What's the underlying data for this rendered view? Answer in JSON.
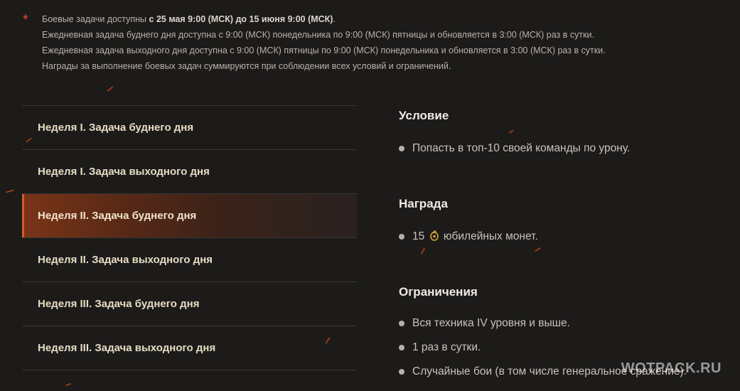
{
  "notes": {
    "asterisk": "*",
    "line1_prefix": "Боевые задачи доступны ",
    "line1_bold": "с 25 мая 9:00 (МСК) до 15 июня 9:00 (МСК)",
    "line1_suffix": ".",
    "line2": "Ежедневная задача буднего дня доступна с 9:00 (МСК) понедельника по 9:00 (МСК) пятницы и обновляется в 3:00 (МСК) раз в сутки.",
    "line3": "Ежедневная задача выходного дня доступна с 9:00 (МСК) пятницы по 9:00 (МСК) понедельника и обновляется в 3:00 (МСК) раз в сутки.",
    "line4": "Награды за выполнение боевых задач суммируются при соблюдении всех условий и ограничений."
  },
  "tasks": [
    {
      "label": "Неделя I. Задача буднего дня"
    },
    {
      "label": "Неделя I. Задача выходного дня"
    },
    {
      "label": "Неделя II. Задача буднего дня"
    },
    {
      "label": "Неделя II. Задача выходного дня"
    },
    {
      "label": "Неделя III. Задача буднего дня"
    },
    {
      "label": "Неделя III. Задача выходного дня"
    }
  ],
  "active_task_index": 2,
  "details": {
    "condition_title": "Условие",
    "condition_items": [
      "Попасть в топ-10 своей команды по урону."
    ],
    "reward_title": "Награда",
    "reward_amount": "15",
    "reward_text": "юбилейных монет.",
    "reward_icon": "coin-icon",
    "limits_title": "Ограничения",
    "limits_items": [
      "Вся техника IV уровня и выше.",
      "1 раз в сутки.",
      "Случайные бои (в том числе генеральное сражение)."
    ]
  },
  "watermark": "WOTPACK.RU",
  "colors": {
    "background": "#1c1b1a",
    "accent": "#d8582a",
    "task_text": "#e6dcc2",
    "coin": "#d9a441"
  }
}
